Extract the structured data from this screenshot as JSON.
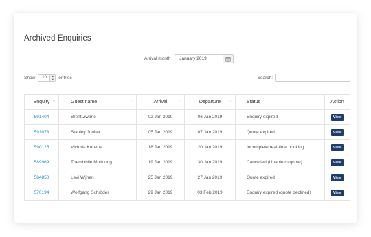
{
  "page": {
    "title": "Archived Enquiries",
    "arrival_month_label": "Arrival month",
    "arrival_month_value": "January 2019",
    "calendar_icon": "calendar-icon"
  },
  "controls": {
    "show_label": "Show",
    "entries_value": "10",
    "entries_label": "entries",
    "search_label": "Search:",
    "search_value": ""
  },
  "table": {
    "headers": [
      "Enquiry",
      "Guest name",
      "Arrival",
      "Departure",
      "Status",
      "Action"
    ],
    "rows": [
      {
        "enquiry": "591404",
        "guest": "Brent Zwane",
        "arrival": "02 Jan 2019",
        "departure": "06 Jan 2019",
        "status": "Enquiry expired",
        "action": "View"
      },
      {
        "enquiry": "591073",
        "guest": "Stanley Jonker",
        "arrival": "05 Jan 2019",
        "departure": "07 Jan 2019",
        "status": "Quote expired",
        "action": "View"
      },
      {
        "enquiry": "590125",
        "guest": "Victoria Kunene",
        "arrival": "18 Jan 2019",
        "departure": "20 Jan 2019",
        "status": "Incomplete real-time booking",
        "action": "View"
      },
      {
        "enquiry": "589969",
        "guest": "Thembisile Motloung",
        "arrival": "19 Jan 2019",
        "departure": "30 Jan 2019",
        "status": "Cancelled (Unable to quote)",
        "action": "View"
      },
      {
        "enquiry": "584850",
        "guest": "Levi Wijnen",
        "arrival": "25 Jan 2019",
        "departure": "27 Jan 2019",
        "status": "Quote expired",
        "action": "View"
      },
      {
        "enquiry": "570194",
        "guest": "Wolfgang Schröder",
        "arrival": "29 Jan 2019",
        "departure": "03 Feb 2019",
        "status": "Enquiry expired (quote declined)",
        "action": "View"
      }
    ]
  },
  "colors": {
    "link": "#1a8fd6",
    "view_button": "#1e3d6b"
  }
}
